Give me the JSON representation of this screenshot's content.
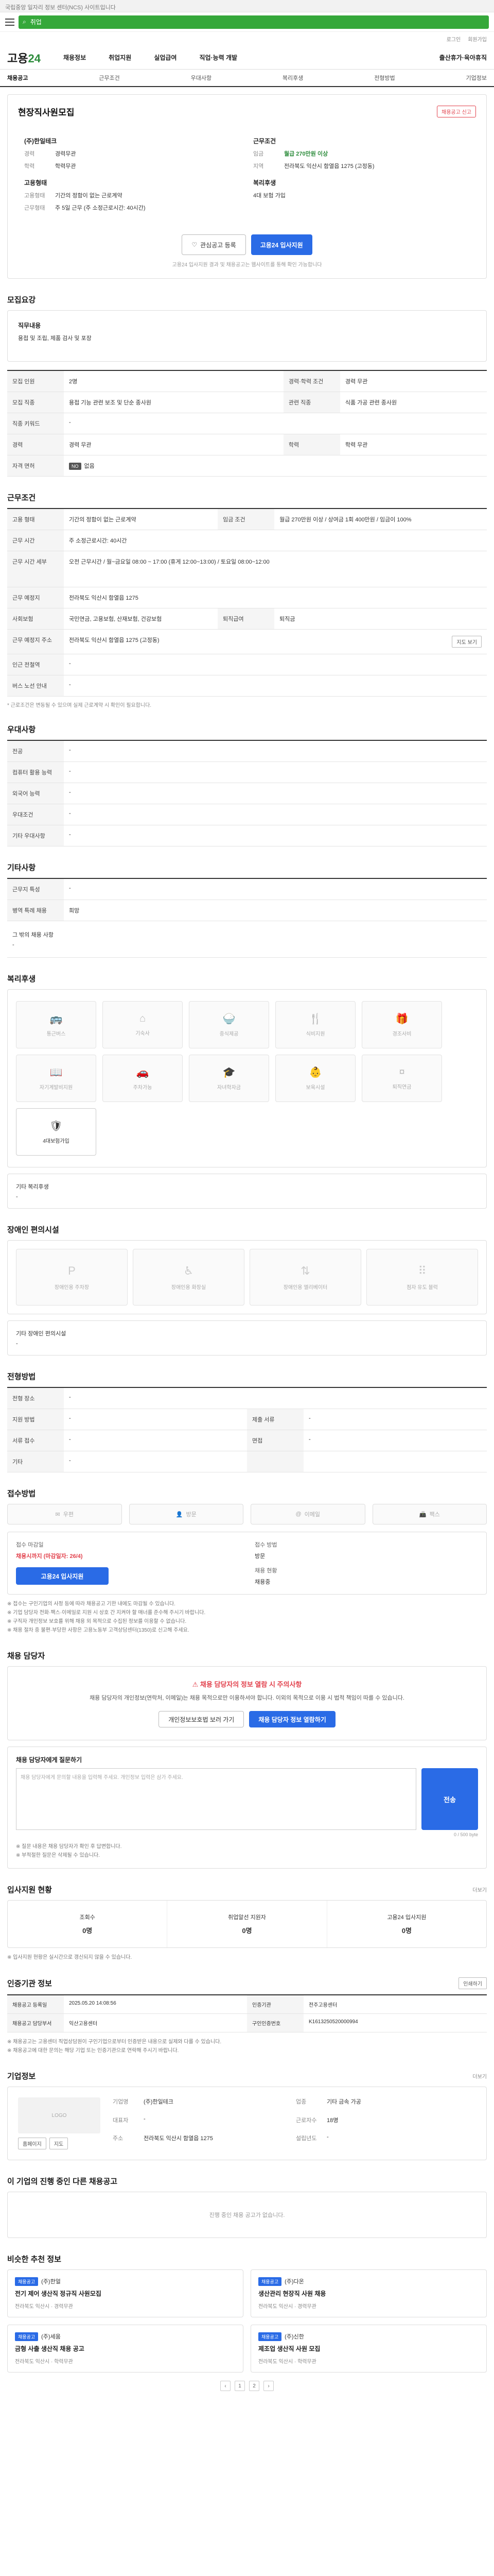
{
  "top_notice": "국립중앙 일자리 정보 센터(NCS) 사이트입니다",
  "search": {
    "placeholder": "취업"
  },
  "util": {
    "login": "로그인",
    "join": "회원가입"
  },
  "gnb": {
    "logo_pre": "고용",
    "logo_num": "24",
    "menus": [
      "채용정보",
      "취업지원",
      "실업급여",
      "직업·능력 개발",
      "출산휴가·육아휴직"
    ]
  },
  "tabs": [
    "채용공고",
    "근무조건",
    "우대사항",
    "복리후생",
    "전형방법",
    "기업정보"
  ],
  "job": {
    "title": "현장직사원모집",
    "report_btn": "채용공고 신고",
    "company": "(주)한일테크",
    "exp_label": "경력",
    "exp": "경력무관",
    "edu_label": "학력",
    "edu": "학력무관",
    "wage_label": "임금",
    "wage": "월급 270만원 이상",
    "loc_label": "지역",
    "loc": "전라북도 익산시 함열읍 1275 (고정동)",
    "ctype_title": "고용형태",
    "ctype_label": "고용형태",
    "ctype": "기간의 정함이 없는 근로계약",
    "work_label": "근무형태",
    "work": "주 5일 근무 (주 소정근로시간: 40시간)",
    "welfare_title": "복리후생",
    "welfare": "4대 보험 가입",
    "scrap_btn": "관심공고 등록",
    "apply_btn": "고용24 입사지원",
    "notice": "고용24 입사지원 결과 및 채용공고는 웹사이트를 통해 확인 가능합니다"
  },
  "duty": {
    "title": "모집요강",
    "heading": "직무내용",
    "body": "용접 및 조립, 제품 검사 및 포장"
  },
  "recruit_table": [
    [
      "모집 인원",
      "2명",
      "경력·학력 조건",
      "경력 무관"
    ],
    [
      "모집 직종",
      "용접 기능 관련 보조 및 단순 종사원",
      "관련 직종",
      "식품 가공 관련 종사원"
    ],
    [
      "직종 키워드",
      "-",
      "",
      ""
    ],
    [
      "경력",
      "경력 무관",
      "학력",
      "학력 무관"
    ],
    [
      "자격 면허",
      "없음",
      "",
      ""
    ]
  ],
  "work_cond": {
    "title": "근무조건",
    "rows": [
      [
        "고용 형태",
        "기간의 정함이 없는 근로계약",
        "임금 조건",
        "월급 270만원 이상 / 상여금 1회 400만원 / 임금이 100%"
      ],
      [
        "근무 시간",
        "주 소정근로시간: 40시간",
        "",
        ""
      ],
      [
        "근무 시간 세부",
        "오전 근무시간 / 월~금요일 08:00 ~ 17:00 (휴게 12:00~13:00) / 토요일 08:00~12:00",
        "",
        ""
      ],
      [
        "근무 예정지",
        "전라북도 익산시 함열읍 1275",
        "",
        ""
      ],
      [
        "사회보험",
        "국민연금, 고용보험, 산재보험, 건강보험",
        "퇴직급여",
        "퇴직금"
      ],
      [
        "근무 예정지 주소",
        "전라북도 익산시 함열읍 1275 (고정동)",
        "",
        ""
      ],
      [
        "인근 전철역",
        "-",
        "",
        ""
      ],
      [
        "버스 노선 안내",
        "-",
        "",
        ""
      ]
    ],
    "map_btn": "지도 보기",
    "note": "* 근로조건은 변동될 수 있으며 실제 근로계약 시 확인이 필요합니다."
  },
  "prefer": {
    "title": "우대사항",
    "rows": [
      [
        "전공",
        "-"
      ],
      [
        "컴퓨터 활용 능력",
        "-"
      ],
      [
        "외국어 능력",
        "-"
      ],
      [
        "우대조건",
        "-"
      ],
      [
        "기타 우대사항",
        "-"
      ]
    ]
  },
  "etc": {
    "title": "기타사항",
    "rows": [
      [
        "근무지 특성",
        "-"
      ],
      [
        "병역 특례 채용",
        "희망"
      ]
    ],
    "other_label": "그 밖의 채용 사항",
    "other": "-"
  },
  "welfare": {
    "title": "복리후생",
    "items": [
      {
        "label": "통근버스",
        "icon": "bus-icon",
        "on": false
      },
      {
        "label": "기숙사",
        "icon": "house-icon",
        "on": false
      },
      {
        "label": "중식제공",
        "icon": "meal-icon",
        "on": false
      },
      {
        "label": "식비지원",
        "icon": "fork-icon",
        "on": false
      },
      {
        "label": "경조사비",
        "icon": "gift-icon",
        "on": false
      },
      {
        "label": "자기계발비지원",
        "icon": "book-icon",
        "on": false
      },
      {
        "label": "주차가능",
        "icon": "car-icon",
        "on": false
      },
      {
        "label": "자녀학자금",
        "icon": "cap-icon",
        "on": false
      },
      {
        "label": "보육시설",
        "icon": "baby-icon",
        "on": false
      },
      {
        "label": "퇴직연금",
        "icon": "coin-icon",
        "on": false
      },
      {
        "label": "4대보험가입",
        "icon": "shield-icon",
        "on": true
      }
    ],
    "other_label": "기타 복리후생",
    "other": "-"
  },
  "disability": {
    "title": "장애인 편의시설",
    "items": [
      "장애인용 주차장",
      "장애인용 화장실",
      "장애인용 엘리베이터",
      "점자 유도 블럭"
    ],
    "other_label": "기타 장애인 편의시설",
    "other": "-"
  },
  "selection": {
    "title": "전형방법",
    "rows": [
      [
        "전형 장소",
        "-",
        "",
        ""
      ],
      [
        "지원 방법",
        "-",
        "제출 서류",
        "-"
      ],
      [
        "서류 접수",
        "-",
        "면접",
        "-"
      ],
      [
        "기타",
        "-",
        "",
        ""
      ]
    ]
  },
  "apply_method": {
    "title": "접수방법",
    "methods": [
      {
        "label": "우편",
        "icon": "mail-icon",
        "on": false
      },
      {
        "label": "방문",
        "icon": "person-icon",
        "on": false
      },
      {
        "label": "이메일",
        "icon": "at-icon",
        "on": false
      },
      {
        "label": "팩스",
        "icon": "fax-icon",
        "on": false
      }
    ],
    "deadline_label": "접수 마감일",
    "deadline": "채용시까지 (마감일자: 26/4)",
    "doc_label": "접수 방법",
    "doc": "방문",
    "status_label": "채용 현황",
    "status": "채용중",
    "apply_btn": "고용24 입사지원",
    "bullets": [
      "※ 접수는 구인기업의 사정 등에 따라 채용공고 기한 내에도 마감될 수 있습니다.",
      "※ 기업 담당자 전화·팩스·이메일로 지원 시 상호 간 지켜야 할 매너를 준수해 주시기 바랍니다.",
      "※ 구직자 개인정보 보호를 위해 채용 외 목적으로 수집된 정보를 이용할 수 없습니다.",
      "※ 채용 절차 중 불편·부당한 사항은 고용노동부 고객상담센터(1350)로 신고해 주세요."
    ]
  },
  "contact": {
    "title": "채용 담당자",
    "warn_title": "채용 담당자의 정보 열람 시 주의사항",
    "warn_desc": "채용 담당자의 개인정보(연락처, 이메일)는 채용 목적으로만 이용하셔야 합니다. 이외의 목적으로 이용 시 법적 책임이 따를 수 있습니다.",
    "btn1": "개인정보보호법 보러 가기",
    "btn2": "채용 담당자 정보 열람하기",
    "qa_title": "채용 담당자에게 질문하기",
    "qa_placeholder": "채용 담당자에게 문의할 내용을 입력해 주세요. 개인정보 입력은 삼가 주세요.",
    "qa_send": "전송",
    "qa_count": "0 / 500 byte",
    "qa_notes": [
      "※ 질문 내용은 채용 담당자가 확인 후 답변합니다.",
      "※ 부적절한 질문은 삭제될 수 있습니다."
    ]
  },
  "stats": {
    "title": "입사지원 현황",
    "more": "더보기",
    "items": [
      {
        "label": "조회수",
        "value": "0명"
      },
      {
        "label": "취업알선 지원자",
        "value": "0명"
      },
      {
        "label": "고용24 입사지원",
        "value": "0명"
      }
    ],
    "note": "※ 입사지원 현황은 실시간으로 갱신되지 않을 수 있습니다."
  },
  "manage": {
    "title": "인증기관 정보",
    "print_btn": "인쇄하기",
    "rows": [
      [
        "채용공고 등록일",
        "2025.05.20 14:08:56",
        "인증기관",
        "전주고용센터"
      ],
      [
        "채용공고 담당부서",
        "익산고용센터",
        "구인인증번호",
        "K1613250520000994"
      ]
    ],
    "bullets": [
      "※ 채용공고는 고용센터 직업상담원이 구인기업으로부터 인증받은 내용으로 실제와 다를 수 있습니다.",
      "※ 채용공고에 대한 문의는 해당 기업 또는 인증기관으로 연락해 주시기 바랍니다."
    ]
  },
  "company": {
    "title": "기업정보",
    "more": "더보기",
    "logo_alt": "LOGO",
    "fields": [
      [
        "기업명",
        "(주)한일테크"
      ],
      [
        "업종",
        "기타 금속 가공"
      ],
      [
        "대표자",
        "-"
      ],
      [
        "근로자수",
        "18명"
      ],
      [
        "주소",
        "전라북도 익산시 함열읍 1275"
      ],
      [
        "설립년도",
        "-"
      ]
    ],
    "btn_home": "홈페이지",
    "btn_map": "지도"
  },
  "other_jobs": {
    "title": "이 기업의 진행 중인 다른 채용공고",
    "empty": "진행 중인 채용 공고가 없습니다."
  },
  "similar": {
    "title": "비슷한 추천 정보",
    "cards": [
      {
        "badge": "채용공고",
        "co": "(주)한얼",
        "title": "전기 제어 생산직 정규직 사원모집",
        "meta": "전라북도 익산시 · 경력무관"
      },
      {
        "badge": "채용공고",
        "co": "(주)다온",
        "title": "생산관리 현장직 사원 채용",
        "meta": "전라북도 익산시 · 경력무관"
      },
      {
        "badge": "채용공고",
        "co": "(주)세움",
        "title": "금형 사출 생산직 채용 공고",
        "meta": "전라북도 익산시 · 학력무관"
      },
      {
        "badge": "채용공고",
        "co": "(주)신한",
        "title": "제조업 생산직 사원 모집",
        "meta": "전라북도 익산시 · 학력무관"
      }
    ],
    "pages": [
      "‹",
      "1",
      "2",
      "›"
    ]
  }
}
